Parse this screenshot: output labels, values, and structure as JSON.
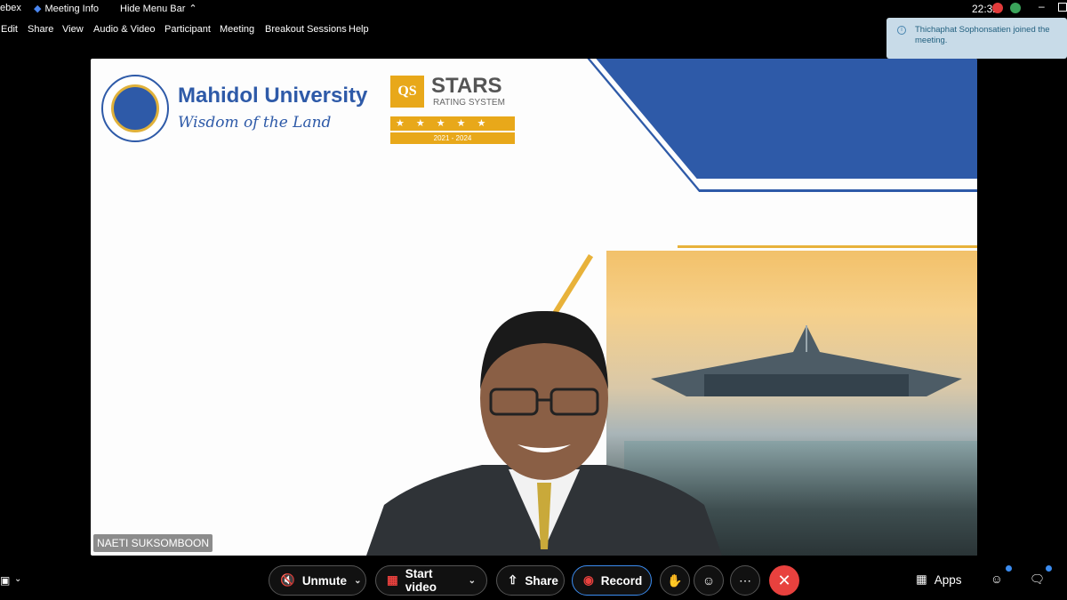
{
  "titlebar": {
    "app_name": "ebex",
    "meeting_info": "Meeting Info",
    "hide_menu_bar": "Hide Menu Bar",
    "clock": "22:32"
  },
  "menu": {
    "items": [
      "Edit",
      "Share",
      "View",
      "Audio & Video",
      "Participant",
      "Meeting",
      "Breakout Sessions",
      "Help"
    ]
  },
  "toast": {
    "message": "Thichaphat Sophonsatien joined the meeting."
  },
  "slide": {
    "university": "Mahidol University",
    "motto": "Wisdom of the Land",
    "qs": "QS",
    "stars_title": "STARS",
    "stars_sub": "RATING SYSTEM",
    "years": "2021 - 2024"
  },
  "presenter": {
    "name": "NAETI SUKSOMBOON"
  },
  "controls": {
    "unmute": "Unmute",
    "start_video": "Start video",
    "share": "Share",
    "record": "Record",
    "apps": "Apps"
  },
  "colors": {
    "accent_red": "#e8413e",
    "brand_blue": "#2e5aa8",
    "gold": "#e8b23a",
    "toast_bg": "#c8dbe8"
  }
}
